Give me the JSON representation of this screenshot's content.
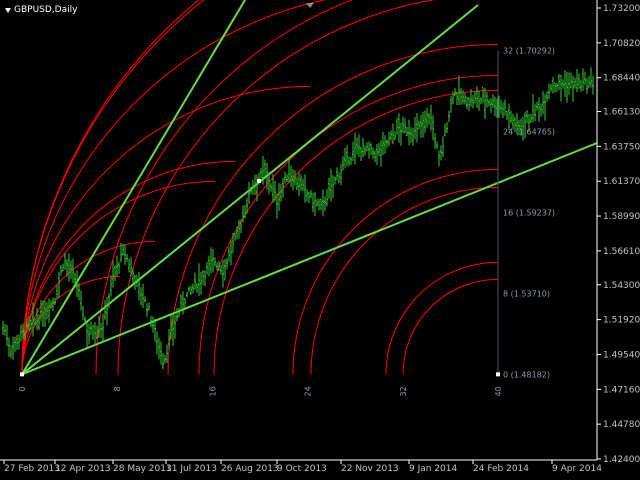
{
  "window": {
    "symbol_timeframe": "GBPUSD,Daily",
    "menu_icon": "chevron-down-icon"
  },
  "colors": {
    "background": "#000000",
    "price_bars": "#32cd32",
    "fan_lines": "#66dd44",
    "arcs": "#ff0000",
    "axis": "#ffffff",
    "axis_text": "#c0c0c0",
    "level_text": "#8a9aa8"
  },
  "price_axis": {
    "labels": [
      "1.73200",
      "1.70820",
      "1.68440",
      "1.66130",
      "1.63750",
      "1.61370",
      "1.58990",
      "1.56610",
      "1.54300",
      "1.51920",
      "1.49540",
      "1.47160",
      "1.44780",
      "1.42400"
    ]
  },
  "time_axis": {
    "labels": [
      "27 Feb 2013",
      "12 Apr 2013",
      "28 May 2013",
      "11 Jul 2013",
      "26 Aug 2013",
      "9 Oct 2013",
      "22 Nov 2013",
      "9 Jan 2014",
      "24 Feb 2014",
      "9 Apr 2014"
    ]
  },
  "gann_tool": {
    "type": "Gann fan with arcs",
    "anchor_date": "27 Feb 2013",
    "anchor_price": 1.48182,
    "time_marks": [
      "0",
      "8",
      "16",
      "24",
      "32",
      "40"
    ],
    "price_levels": [
      {
        "label": "0 (1.48182)",
        "price": 1.48182
      },
      {
        "label": "8 (1.53710)",
        "price": 1.5371
      },
      {
        "label": "16 (1.59237)",
        "price": 1.59237
      },
      {
        "label": "24 (1.64765)",
        "price": 1.64765
      },
      {
        "label": "32 (1.70292)",
        "price": 1.70292
      }
    ],
    "fan_lines": 3,
    "arc_count": 7
  },
  "chart_data": {
    "type": "ohlc",
    "symbol": "GBPUSD",
    "timeframe": "Daily",
    "x_range": [
      "27 Feb 2013",
      "9 Apr 2014"
    ],
    "ylim": [
      1.424,
      1.732
    ],
    "grid": false,
    "close_path": [
      {
        "date": "27 Feb 2013",
        "price": 1.514
      },
      {
        "date": "5 Mar 2013",
        "price": 1.499
      },
      {
        "date": "14 Mar 2013",
        "price": 1.509
      },
      {
        "date": "28 Mar 2013",
        "price": 1.519
      },
      {
        "date": "12 Apr 2013",
        "price": 1.533
      },
      {
        "date": "19 Apr 2013",
        "price": 1.56
      },
      {
        "date": "29 Apr 2013",
        "price": 1.545
      },
      {
        "date": "8 May 2013",
        "price": 1.51
      },
      {
        "date": "20 May 2013",
        "price": 1.515
      },
      {
        "date": "28 May 2013",
        "price": 1.548
      },
      {
        "date": "6 Jun 2013",
        "price": 1.566
      },
      {
        "date": "14 Jun 2013",
        "price": 1.55
      },
      {
        "date": "27 Jun 2013",
        "price": 1.525
      },
      {
        "date": "9 Jul 2013",
        "price": 1.49
      },
      {
        "date": "16 Jul 2013",
        "price": 1.512
      },
      {
        "date": "26 Jul 2013",
        "price": 1.533
      },
      {
        "date": "7 Aug 2013",
        "price": 1.545
      },
      {
        "date": "20 Aug 2013",
        "price": 1.56
      },
      {
        "date": "28 Aug 2013",
        "price": 1.553
      },
      {
        "date": "9 Sep 2013",
        "price": 1.58
      },
      {
        "date": "19 Sep 2013",
        "price": 1.61
      },
      {
        "date": "30 Sep 2013",
        "price": 1.621
      },
      {
        "date": "9 Oct 2013",
        "price": 1.6
      },
      {
        "date": "17 Oct 2013",
        "price": 1.62
      },
      {
        "date": "30 Oct 2013",
        "price": 1.605
      },
      {
        "date": "8 Nov 2013",
        "price": 1.595
      },
      {
        "date": "22 Nov 2013",
        "price": 1.622
      },
      {
        "date": "4 Dec 2013",
        "price": 1.637
      },
      {
        "date": "17 Dec 2013",
        "price": 1.632
      },
      {
        "date": "2 Jan 2014",
        "price": 1.65
      },
      {
        "date": "14 Jan 2014",
        "price": 1.647
      },
      {
        "date": "24 Jan 2014",
        "price": 1.66
      },
      {
        "date": "31 Jan 2014",
        "price": 1.627
      },
      {
        "date": "10 Feb 2014",
        "price": 1.675
      },
      {
        "date": "20 Feb 2014",
        "price": 1.668
      },
      {
        "date": "3 Mar 2014",
        "price": 1.67
      },
      {
        "date": "14 Mar 2014",
        "price": 1.663
      },
      {
        "date": "21 Mar 2014",
        "price": 1.65
      },
      {
        "date": "3 Apr 2014",
        "price": 1.665
      },
      {
        "date": "9 Apr 2014",
        "price": 1.68
      }
    ]
  }
}
